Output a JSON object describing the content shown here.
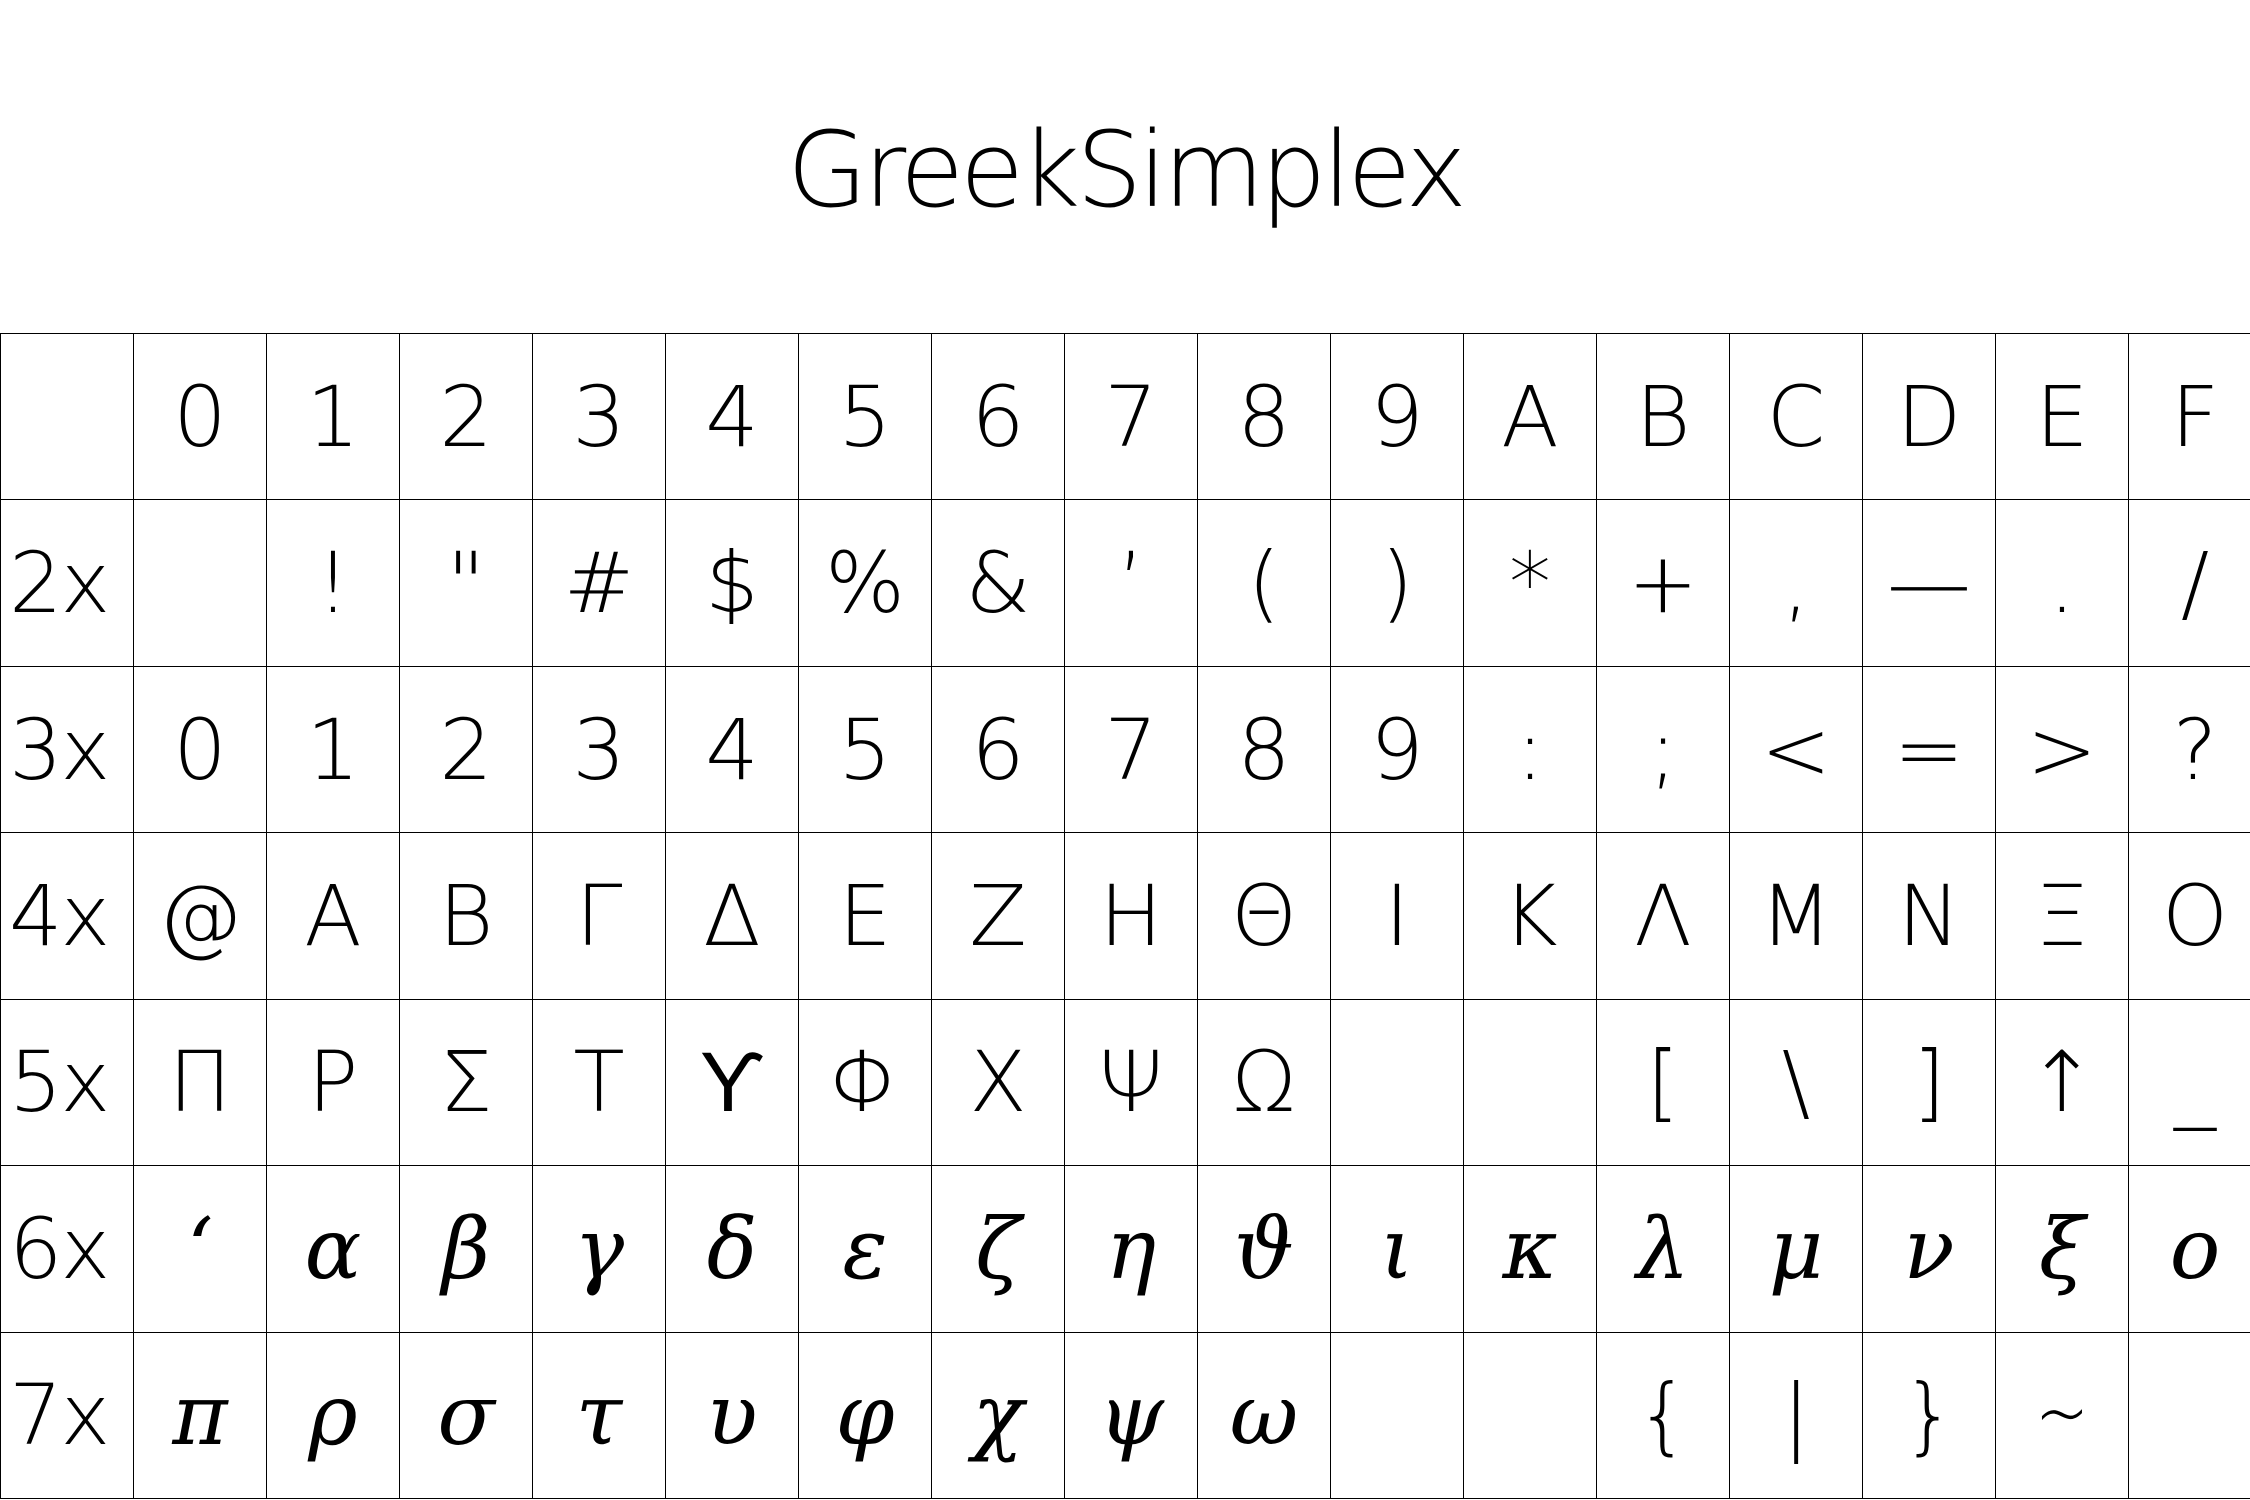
{
  "title": "GreekSimplex",
  "header": {
    "corner": "",
    "columns": [
      "0",
      "1",
      "2",
      "3",
      "4",
      "5",
      "6",
      "7",
      "8",
      "9",
      "A",
      "B",
      "C",
      "D",
      "E",
      "F"
    ]
  },
  "rows": [
    {
      "label": "2x",
      "cells": [
        "",
        "!",
        "\"",
        "#",
        "$",
        "%",
        "&",
        "’",
        "(",
        ")",
        "*",
        "+",
        ",",
        "—",
        ".",
        "/"
      ]
    },
    {
      "label": "3x",
      "cells": [
        "0",
        "1",
        "2",
        "3",
        "4",
        "5",
        "6",
        "7",
        "8",
        "9",
        ":",
        ";",
        "<",
        "=",
        ">",
        "?"
      ]
    },
    {
      "label": "4x",
      "cells": [
        "@",
        "A",
        "B",
        "Γ",
        "Δ",
        "E",
        "Z",
        "H",
        "Θ",
        "I",
        "K",
        "Λ",
        "M",
        "N",
        "Ξ",
        "O"
      ]
    },
    {
      "label": "5x",
      "cells": [
        "Π",
        "P",
        "Σ",
        "T",
        "ϒ",
        "Φ",
        "X",
        "Ψ",
        "Ω",
        "",
        "",
        "[",
        "\\",
        "]",
        "↑",
        "_"
      ]
    },
    {
      "label": "6x",
      "cells": [
        "‘",
        "α",
        "β",
        "γ",
        "δ",
        "ε",
        "ζ",
        "η",
        "ϑ",
        "ι",
        "κ",
        "λ",
        "μ",
        "ν",
        "ξ",
        "ο"
      ]
    },
    {
      "label": "7x",
      "cells": [
        "π",
        "ρ",
        "σ",
        "τ",
        "υ",
        "φ",
        "χ",
        "ψ",
        "ω",
        "",
        "",
        "{",
        "|",
        "}",
        "∼",
        ""
      ]
    }
  ]
}
